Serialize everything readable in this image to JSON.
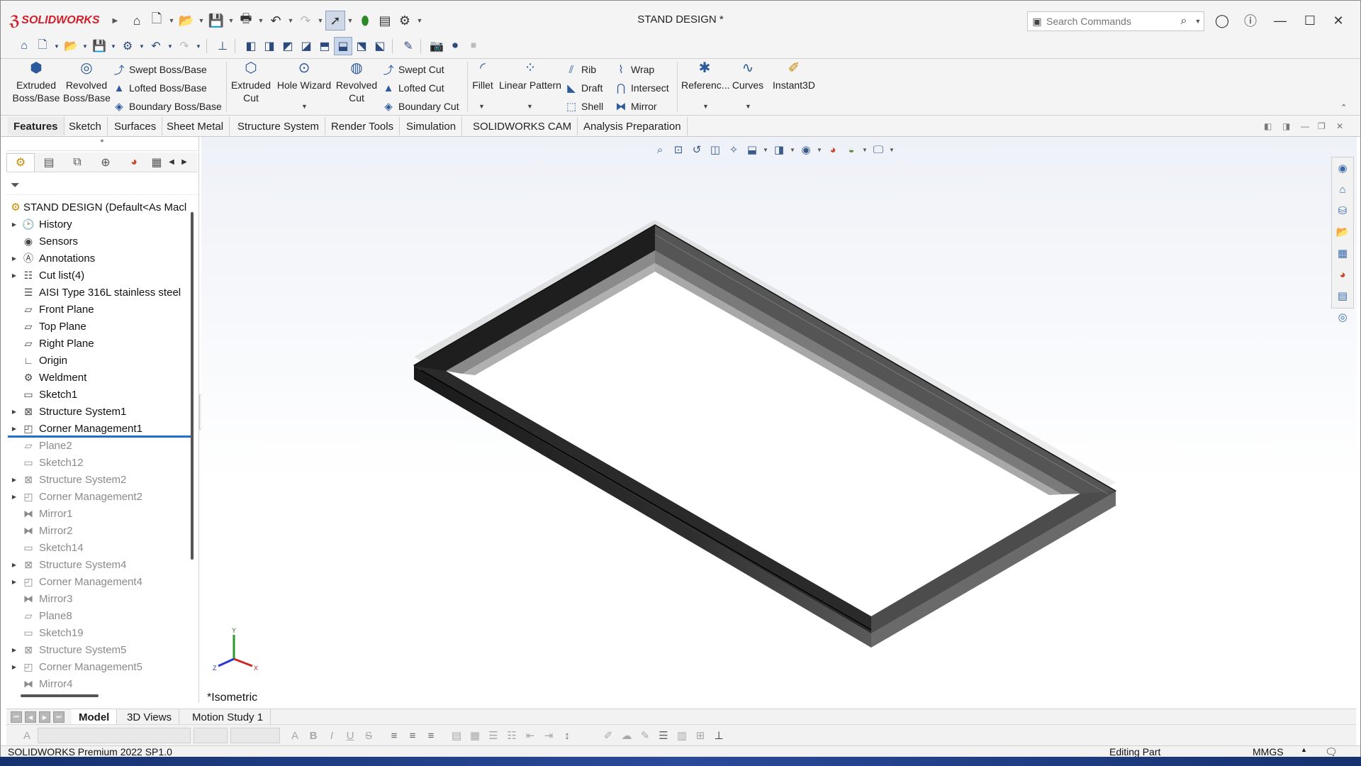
{
  "app": {
    "logo_text": "SOLIDWORKS",
    "document_title": "STAND DESIGN *"
  },
  "search": {
    "placeholder": "Search Commands"
  },
  "ribbon": {
    "extruded_boss": "Extruded Boss/Base",
    "revolved_boss": "Revolved Boss/Base",
    "swept_boss": "Swept Boss/Base",
    "lofted_boss": "Lofted Boss/Base",
    "boundary_boss": "Boundary Boss/Base",
    "extruded_cut": "Extruded Cut",
    "hole_wizard": "Hole Wizard",
    "revolved_cut": "Revolved Cut",
    "swept_cut": "Swept Cut",
    "lofted_cut": "Lofted Cut",
    "boundary_cut": "Boundary Cut",
    "fillet": "Fillet",
    "linear_pattern": "Linear Pattern",
    "rib": "Rib",
    "draft": "Draft",
    "shell": "Shell",
    "wrap": "Wrap",
    "intersect": "Intersect",
    "mirror": "Mirror",
    "reference": "Referenc...",
    "curves": "Curves",
    "instant3d": "Instant3D"
  },
  "tabs": [
    "Features",
    "Sketch",
    "Surfaces",
    "Sheet Metal",
    "Structure System",
    "Render Tools",
    "Simulation",
    "SOLIDWORKS CAM",
    "Analysis Preparation"
  ],
  "tree": {
    "root": "STAND DESIGN  (Default<As Macl",
    "items": [
      {
        "label": "History",
        "icon": "history-icon",
        "expand": true,
        "state": "normal"
      },
      {
        "label": "Sensors",
        "icon": "sensor-icon",
        "expand": false,
        "state": "normal"
      },
      {
        "label": "Annotations",
        "icon": "annotation-icon",
        "expand": true,
        "state": "normal"
      },
      {
        "label": "Cut list(4)",
        "icon": "cut-list-icon",
        "expand": true,
        "state": "normal"
      },
      {
        "label": "AISI Type 316L stainless steel",
        "icon": "material-icon",
        "expand": false,
        "state": "normal"
      },
      {
        "label": "Front Plane",
        "icon": "plane-icon",
        "expand": false,
        "state": "normal"
      },
      {
        "label": "Top Plane",
        "icon": "plane-icon",
        "expand": false,
        "state": "normal"
      },
      {
        "label": "Right Plane",
        "icon": "plane-icon",
        "expand": false,
        "state": "normal"
      },
      {
        "label": "Origin",
        "icon": "origin-icon",
        "expand": false,
        "state": "normal"
      },
      {
        "label": "Weldment",
        "icon": "weldment-icon",
        "expand": false,
        "state": "normal"
      },
      {
        "label": "Sketch1",
        "icon": "sketch-icon",
        "expand": false,
        "state": "normal"
      },
      {
        "label": "Structure System1",
        "icon": "structure-system-icon",
        "expand": true,
        "state": "normal"
      },
      {
        "label": "Corner Management1",
        "icon": "corner-management-icon",
        "expand": true,
        "state": "rollback"
      },
      {
        "label": "Plane2",
        "icon": "plane-icon",
        "expand": false,
        "state": "suppressed"
      },
      {
        "label": "Sketch12",
        "icon": "sketch-icon",
        "expand": false,
        "state": "suppressed"
      },
      {
        "label": "Structure System2",
        "icon": "structure-system-icon",
        "expand": true,
        "state": "suppressed"
      },
      {
        "label": "Corner Management2",
        "icon": "corner-management-icon",
        "expand": true,
        "state": "suppressed"
      },
      {
        "label": "Mirror1",
        "icon": "mirror-icon",
        "expand": false,
        "state": "suppressed"
      },
      {
        "label": "Mirror2",
        "icon": "mirror-icon",
        "expand": false,
        "state": "suppressed"
      },
      {
        "label": "Sketch14",
        "icon": "sketch-icon",
        "expand": false,
        "state": "suppressed"
      },
      {
        "label": "Structure System4",
        "icon": "structure-system-icon",
        "expand": true,
        "state": "suppressed"
      },
      {
        "label": "Corner Management4",
        "icon": "corner-management-icon",
        "expand": true,
        "state": "suppressed"
      },
      {
        "label": "Mirror3",
        "icon": "mirror-icon",
        "expand": false,
        "state": "suppressed"
      },
      {
        "label": "Plane8",
        "icon": "plane-icon",
        "expand": false,
        "state": "suppressed"
      },
      {
        "label": "Sketch19",
        "icon": "sketch-icon",
        "expand": false,
        "state": "suppressed"
      },
      {
        "label": "Structure System5",
        "icon": "structure-system-icon",
        "expand": true,
        "state": "suppressed"
      },
      {
        "label": "Corner Management5",
        "icon": "corner-management-icon",
        "expand": true,
        "state": "suppressed"
      },
      {
        "label": "Mirror4",
        "icon": "mirror-icon",
        "expand": false,
        "state": "suppressed"
      }
    ]
  },
  "viewport": {
    "view_label": "*Isometric",
    "triad": {
      "x": "X",
      "y": "Y",
      "z": "Z"
    }
  },
  "bottom_tabs": [
    "Model",
    "3D Views",
    "Motion Study 1"
  ],
  "status": {
    "product": "SOLIDWORKS Premium 2022 SP1.0",
    "mode": "Editing Part",
    "units": "MMGS"
  },
  "colors": {
    "brand": "#d11f2a",
    "rollback_bar": "#1f6fd1",
    "suppressed_text": "#8a8a8a"
  }
}
